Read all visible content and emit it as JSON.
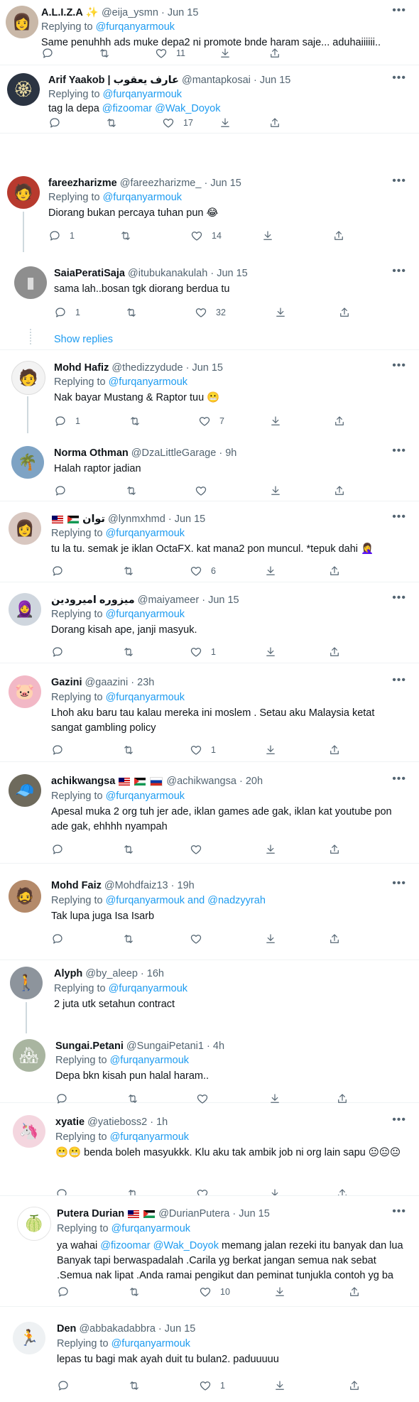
{
  "icons": {
    "reply": "reply-icon",
    "retweet": "retweet-icon",
    "like": "heart-icon",
    "save": "download-icon",
    "share": "share-icon",
    "more": "more-icon"
  },
  "colors": {
    "link": "#1d9bf0",
    "muted": "#536471",
    "text": "#0f1419"
  },
  "more_glyph": "•••",
  "replying_to_label": "Replying to",
  "show_replies": "Show replies",
  "tweets": [
    {
      "name": "A.L.I.Z.A",
      "name_suffix": "✨",
      "handle": "@eija_ysmn",
      "time": "Jun 15",
      "reply_to": "@furqanyarmouk",
      "text": "Same penuhhh ads muke depa2 ni promote bnde haram saje... aduhaiiiiii..",
      "likes": "11"
    },
    {
      "name": "Arif Yaakob | عارف يعقوب",
      "handle": "@mantapkosai",
      "time": "Jun 15",
      "reply_to": "@furqanyarmouk",
      "text_pre": "tag la depa ",
      "text_link": "@fizoomar @Wak_Doyok",
      "likes": "17"
    },
    {
      "name": "fareezharizme",
      "handle": "@fareezharizme_",
      "time": "Jun 15",
      "reply_to": "@furqanyarmouk",
      "text": "Diorang bukan percaya tuhan pun 😂",
      "replies": "1",
      "likes": "14"
    },
    {
      "name": "SaiaPeratiSaja",
      "handle": "@itubukanakulah",
      "time": "Jun 15",
      "text": "sama lah..bosan tgk diorang berdua tu",
      "replies": "1",
      "likes": "32"
    },
    {
      "name": "Mohd Hafiz",
      "handle": "@thedizzydude",
      "time": "Jun 15",
      "reply_to": "@furqanyarmouk",
      "text": "Nak bayar Mustang & Raptor tuu 😬",
      "replies": "1",
      "likes": "7"
    },
    {
      "name": "Norma Othman",
      "handle": "@DzaLittleGarage",
      "time": "9h",
      "text": "Halah raptor jadian"
    },
    {
      "name": "توان",
      "handle": "@lynmxhmd",
      "time": "Jun 15",
      "reply_to": "@furqanyarmouk",
      "text": "tu la tu. semak je iklan OctaFX. kat mana2 pon muncul. *tepuk dahi 🤦‍♀️",
      "likes": "6"
    },
    {
      "name": "ميزوره اميرودين",
      "handle": "@maiyameer",
      "time": "Jun 15",
      "reply_to": "@furqanyarmouk",
      "text": "Dorang kisah ape, janji masyuk.",
      "likes": "1"
    },
    {
      "name": "Gazini",
      "handle": "@gaazini",
      "time": "23h",
      "reply_to": "@furqanyarmouk",
      "text": "Lhoh aku baru tau kalau mereka ini moslem . Setau aku Malaysia ketat sangat gambling policy",
      "likes": "1"
    },
    {
      "name": "achikwangsa",
      "handle": "@achikwangsa",
      "time": "20h",
      "reply_to": "@furqanyarmouk",
      "text": "Apesal muka 2 org tuh jer ade, iklan games ade gak, iklan kat youtube pon ade gak, ehhhh nyampah"
    },
    {
      "name": "Mohd Faiz",
      "handle": "@Mohdfaiz13",
      "time": "19h",
      "reply_to": "@furqanyarmouk and @nadzyyrah",
      "text": "Tak lupa juga Isa Isarb"
    },
    {
      "name": "Alyph",
      "handle": "@by_aleep",
      "time": "16h",
      "reply_to": "@furqanyarmouk",
      "text": "2 juta utk setahun contract"
    },
    {
      "name": "Sungai.Petani",
      "handle": "@SungaiPetani1",
      "time": "4h",
      "reply_to": "@furqanyarmouk",
      "text": "Depa bkn kisah pun halal haram.."
    },
    {
      "name": "xyatie",
      "handle": "@yatieboss2",
      "time": "1h",
      "reply_to": "@furqanyarmouk",
      "text": "😬😬 benda boleh masyukkk.  Klu aku tak ambik job ni org lain sapu  😐😐😐"
    },
    {
      "name": "Putera Durian",
      "handle": "@DurianPutera",
      "time": "Jun 15",
      "reply_to": "@furqanyarmouk",
      "text_pre": "ya wahai ",
      "text_link": "@fizoomar @Wak_Doyok",
      "text_post": " memang jalan rezeki itu banyak dan lua",
      "text_line2": "Banyak tapi berwaspadalah .Carila yg berkat jangan semua nak sebat",
      "text_line3": ".Semua nak lipat .Anda ramai pengikut dan peminat tunjukla contoh yg ba",
      "likes": "10"
    },
    {
      "name": "Den",
      "handle": "@abbakadabbra",
      "time": "Jun 15",
      "reply_to": "@furqanyarmouk",
      "text": "lepas tu bagi mak ayah duit tu bulan2. paduuuuu",
      "likes": "1"
    }
  ]
}
